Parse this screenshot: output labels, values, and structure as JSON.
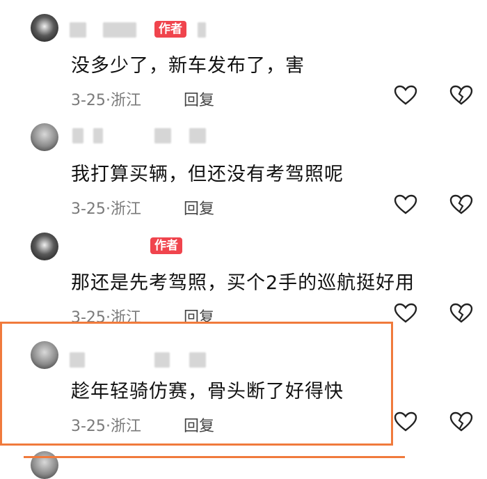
{
  "comments": [
    {
      "badge": "作者",
      "text": "没多少了，新车发布了，害",
      "date": "3-25",
      "location": "浙江",
      "reply": "回复"
    },
    {
      "badge": "",
      "text": "我打算买辆，但还没有考驾照呢",
      "date": "3-25",
      "location": "浙江",
      "reply": "回复"
    },
    {
      "badge": "作者",
      "text": "那还是先考驾照，买个2手的巡航挺好用",
      "date": "3-25",
      "location": "浙江",
      "reply": "回复"
    },
    {
      "badge": "",
      "text": "趁年轻骑仿赛，骨头断了好得快",
      "date": "3-25",
      "location": "浙江",
      "reply": "回复"
    }
  ],
  "meta_separator": "·",
  "icons": {
    "like": "heart-outline-icon",
    "dislike": "broken-heart-icon"
  },
  "colors": {
    "author_badge": "#f0444d",
    "highlight_border": "#f07a3c"
  }
}
